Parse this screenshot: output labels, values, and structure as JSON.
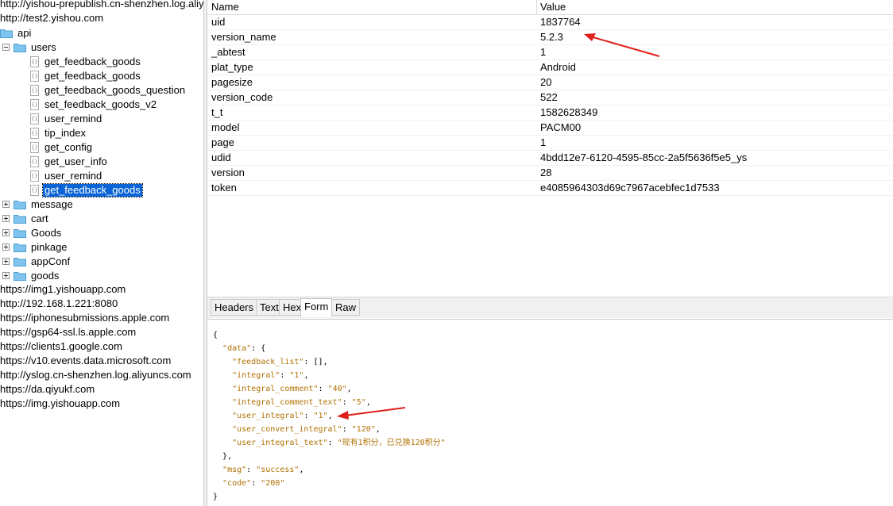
{
  "tree": {
    "top_host_partial": "http://yishou-prepublish.cn-shenzhen.log.aliyuncs.com",
    "host": "http://test2.yishou.com",
    "api": "api",
    "users": "users",
    "user_items": [
      "get_feedback_goods",
      "get_feedback_goods",
      "get_feedback_goods_question",
      "set_feedback_goods_v2",
      "user_remind",
      "tip_index",
      "get_config",
      "get_user_info",
      "user_remind",
      "get_feedback_goods"
    ],
    "folders": [
      "message",
      "cart",
      "Goods",
      "pinkage",
      "appConf",
      "goods"
    ],
    "hosts": [
      "https://img1.yishouapp.com",
      "http://192.168.1.221:8080",
      "https://iphonesubmissions.apple.com",
      "https://gsp64-ssl.ls.apple.com",
      "https://clients1.google.com",
      "https://v10.events.data.microsoft.com",
      "http://yslog.cn-shenzhen.log.aliyuncs.com",
      "https://da.qiyukf.com",
      "https://img.yishouapp.com"
    ]
  },
  "grid": {
    "col_name": "Name",
    "col_value": "Value",
    "rows": [
      {
        "name": "uid",
        "value": "1837764"
      },
      {
        "name": "version_name",
        "value": "5.2.3"
      },
      {
        "name": "_abtest",
        "value": "1"
      },
      {
        "name": "plat_type",
        "value": "Android"
      },
      {
        "name": "pagesize",
        "value": "20"
      },
      {
        "name": "version_code",
        "value": "522"
      },
      {
        "name": "t_t",
        "value": "1582628349"
      },
      {
        "name": "model",
        "value": "PACM00"
      },
      {
        "name": "page",
        "value": "1"
      },
      {
        "name": "udid",
        "value": "4bdd12e7-6120-4595-85cc-2a5f5636f5e5_ys"
      },
      {
        "name": "version",
        "value": "28"
      },
      {
        "name": "token",
        "value": "e4085964303d69c7967acebfec1d7533"
      }
    ]
  },
  "tabs": [
    "Headers",
    "Text",
    "Hex",
    "Form",
    "Raw"
  ],
  "active_tab": "Form",
  "response": {
    "lines": [
      {
        "indent": 0,
        "text": "{"
      },
      {
        "indent": 1,
        "key": "data",
        "punct": ": {"
      },
      {
        "indent": 2,
        "key": "feedback_list",
        "punct": ": [],"
      },
      {
        "indent": 2,
        "key": "integral",
        "val": "1",
        "punct": ","
      },
      {
        "indent": 2,
        "key": "integral_comment",
        "val": "40",
        "punct": ","
      },
      {
        "indent": 2,
        "key": "integral_comment_text",
        "val": "5",
        "punct": ","
      },
      {
        "indent": 2,
        "key": "user_integral",
        "val": "1",
        "punct": ","
      },
      {
        "indent": 2,
        "key": "user_convert_integral",
        "val": "120",
        "punct": ","
      },
      {
        "indent": 2,
        "key": "user_integral_text",
        "val": "现有1积分，已兑换120积分",
        "punct": ""
      },
      {
        "indent": 1,
        "text": "},"
      },
      {
        "indent": 1,
        "key": "msg",
        "val": "success",
        "punct": ","
      },
      {
        "indent": 1,
        "key": "code",
        "val": "200",
        "punct": ""
      },
      {
        "indent": 0,
        "text": "}"
      }
    ]
  },
  "colors": {
    "selection": "#0a64d6",
    "folder": "#7fc4ef",
    "json_string": "#b07000",
    "arrow": "#e0201b"
  }
}
